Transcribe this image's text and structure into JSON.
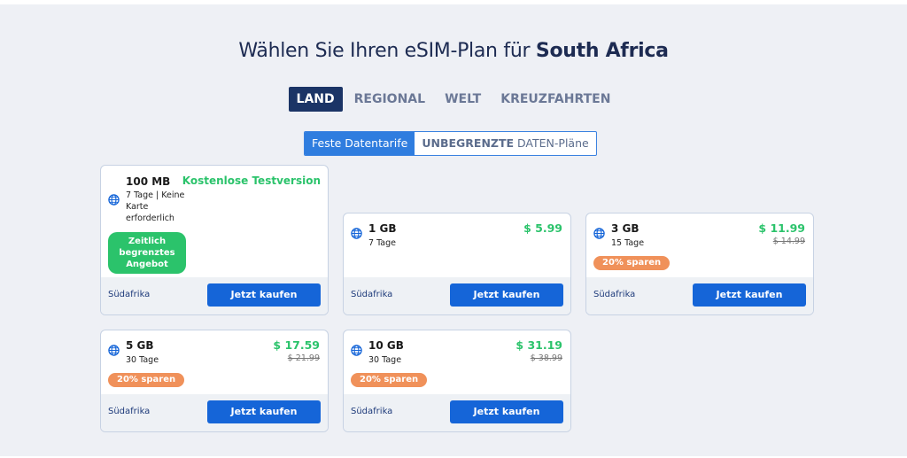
{
  "header": {
    "title_prefix": "Wählen Sie Ihren eSIM-Plan für",
    "title_country": "South Africa"
  },
  "tabs": [
    {
      "label": "LAND",
      "active": true
    },
    {
      "label": "REGIONAL",
      "active": false
    },
    {
      "label": "WELT",
      "active": false
    },
    {
      "label": "KREUZFAHRTEN",
      "active": false
    }
  ],
  "toggle": {
    "fixed_label": "Feste Datentarife",
    "unlimited_bold": "UNBEGRENZTE",
    "unlimited_rest": " DATEN-Pläne"
  },
  "colors": {
    "brand_dark": "#1b3466",
    "accent_blue": "#1565d8",
    "price_green": "#2bc36b",
    "save_orange": "#f0915a"
  },
  "icons": {
    "plan": "globe-icon"
  },
  "plans": {
    "p100mb": {
      "data": "100 MB",
      "days_line1": "7 Tage | Keine",
      "days_line2": "Karte",
      "days_line3": "erforderlich",
      "trial": "Kostenlose Testversion",
      "offer_line1": "Zeitlich",
      "offer_line2": "begrenztes",
      "offer_line3": "Angebot",
      "country": "Südafrika",
      "buy": "Jetzt kaufen"
    },
    "p1gb": {
      "data": "1 GB",
      "days": "7 Tage",
      "price": "$ 5.99",
      "country": "Südafrika",
      "buy": "Jetzt kaufen"
    },
    "p3gb": {
      "data": "3 GB",
      "days": "15 Tage",
      "price": "$ 11.99",
      "old_price": "$ 14.99",
      "save": "20% sparen",
      "country": "Südafrika",
      "buy": "Jetzt kaufen"
    },
    "p5gb": {
      "data": "5 GB",
      "days": "30 Tage",
      "price": "$ 17.59",
      "old_price": "$ 21.99",
      "save": "20% sparen",
      "country": "Südafrika",
      "buy": "Jetzt kaufen"
    },
    "p10gb": {
      "data": "10 GB",
      "days": "30 Tage",
      "price": "$ 31.19",
      "old_price": "$ 38.99",
      "save": "20% sparen",
      "country": "Südafrika",
      "buy": "Jetzt kaufen"
    }
  }
}
